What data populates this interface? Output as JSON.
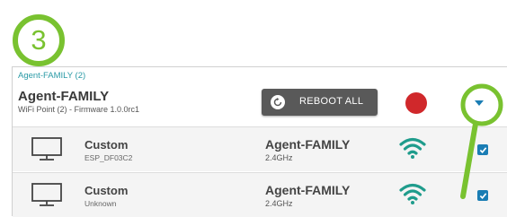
{
  "annotation": {
    "step_number": "3",
    "color": "#79c230"
  },
  "group": {
    "breadcrumb": "Agent-FAMILY (2)",
    "name": "Agent-FAMILY",
    "subtitle": "WiFi Point (2) - Firmware 1.0.0rc1",
    "reboot_label": "REBOOT ALL",
    "status_color": "#d0282b"
  },
  "devices": [
    {
      "name": "Custom",
      "id": "ESP_DF03C2",
      "network": "Agent-FAMILY",
      "band": "2.4GHz",
      "checked": true,
      "icon": "monitor-icon"
    },
    {
      "name": "Custom",
      "id": "Unknown",
      "network": "Agent-FAMILY",
      "band": "2.4GHz",
      "checked": true,
      "icon": "monitor-icon"
    }
  ],
  "colors": {
    "accent": "#1a7db4",
    "wifi": "#1f9c8c",
    "breadcrumb": "#2a9aa6"
  }
}
